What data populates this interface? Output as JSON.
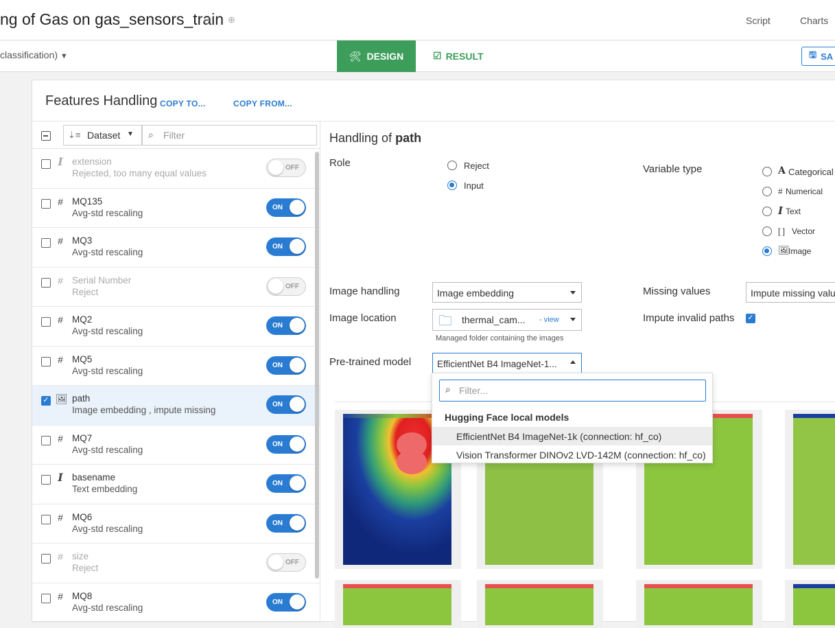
{
  "header": {
    "title": "ng of Gas on gas_sensors_train",
    "nav": [
      "Script",
      "Charts"
    ],
    "subtitle": "classification)",
    "tab_design": "DESIGN",
    "tab_result": "RESULT",
    "save_label": "SA"
  },
  "panel": {
    "title": "Features Handling",
    "copy_to": "COPY TO...",
    "copy_from": "COPY FROM..."
  },
  "list_toolbar": {
    "sort_label": "Dataset",
    "filter_placeholder": "Filter"
  },
  "features": [
    {
      "type": "I",
      "name": "extension",
      "desc": "Rejected, too many equal values",
      "state": "OFF",
      "enabled": false
    },
    {
      "type": "#",
      "name": "MQ135",
      "desc": "Avg-std rescaling",
      "state": "ON",
      "enabled": true
    },
    {
      "type": "#",
      "name": "MQ3",
      "desc": "Avg-std rescaling",
      "state": "ON",
      "enabled": true
    },
    {
      "type": "#",
      "name": "Serial Number",
      "desc": "Reject",
      "state": "OFF",
      "enabled": false
    },
    {
      "type": "#",
      "name": "MQ2",
      "desc": "Avg-std rescaling",
      "state": "ON",
      "enabled": true
    },
    {
      "type": "#",
      "name": "MQ5",
      "desc": "Avg-std rescaling",
      "state": "ON",
      "enabled": true
    },
    {
      "type": "image",
      "name": "path",
      "desc": "Image embedding , impute missing",
      "state": "ON",
      "enabled": true,
      "selected": true
    },
    {
      "type": "#",
      "name": "MQ7",
      "desc": "Avg-std rescaling",
      "state": "ON",
      "enabled": true
    },
    {
      "type": "I",
      "name": "basename",
      "desc": "Text embedding",
      "state": "ON",
      "enabled": true
    },
    {
      "type": "#",
      "name": "MQ6",
      "desc": "Avg-std rescaling",
      "state": "ON",
      "enabled": true
    },
    {
      "type": "#",
      "name": "size",
      "desc": "Reject",
      "state": "OFF",
      "enabled": false
    },
    {
      "type": "#",
      "name": "MQ8",
      "desc": "Avg-std rescaling",
      "state": "ON",
      "enabled": true
    }
  ],
  "handling": {
    "title_prefix": "Handling of ",
    "title_var": "path",
    "role_label": "Role",
    "role_options": [
      "Reject",
      "Input"
    ],
    "role_selected": "Input",
    "vartype_label": "Variable type",
    "vartype_options": [
      {
        "icon": "A",
        "label": "Categorical"
      },
      {
        "icon": "#",
        "label": "Numerical"
      },
      {
        "icon": "I",
        "label": "Text"
      },
      {
        "icon": "[ ]",
        "label": "Vector"
      },
      {
        "icon": "image-icon",
        "label": "Image"
      }
    ],
    "vartype_selected": "Image",
    "image_handling_label": "Image handling",
    "image_handling_value": "Image embedding",
    "missing_values_label": "Missing values",
    "missing_values_value": "Impute missing valu",
    "image_location_label": "Image location",
    "image_location_value": "thermal_cam...",
    "image_location_view": "- view",
    "image_location_hint": "Managed folder containing the images",
    "impute_invalid_label": "Impute invalid paths",
    "impute_invalid_checked": true,
    "pretrained_label": "Pre-trained model",
    "pretrained_value": "EfficientNet B4 ImageNet-1..."
  },
  "dropdown": {
    "filter_placeholder": "Filter...",
    "group_label": "Hugging Face local models",
    "items": [
      "EfficientNet B4 ImageNet-1k (connection: hf_co)",
      "Vision Transformer DINOv2 LVD-142M (connection: hf_co)"
    ],
    "highlighted_index": 0
  },
  "colors": {
    "accent": "#2a7cd3",
    "design_tab": "#3c9e5a",
    "heatmap_low": "#1b3fa0",
    "heatmap_mid": "#8cc63f",
    "heatmap_high": "#e02020"
  }
}
